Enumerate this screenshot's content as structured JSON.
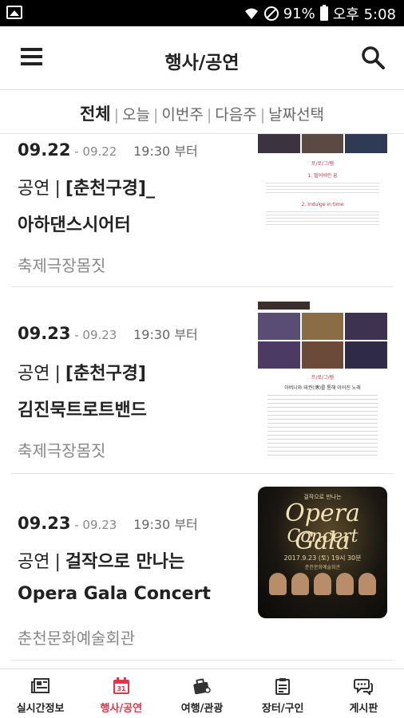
{
  "status": {
    "battery": "91%",
    "time": "오후 5:08"
  },
  "header": {
    "title": "행사/공연"
  },
  "filters": [
    {
      "label": "전체",
      "active": true
    },
    {
      "label": "오늘",
      "active": false
    },
    {
      "label": "이번주",
      "active": false
    },
    {
      "label": "다음주",
      "active": false
    },
    {
      "label": "날짜선택",
      "active": false
    }
  ],
  "filter_separator": "|",
  "events": [
    {
      "start": "09.22",
      "end": "- 09.22",
      "time": "19:30 부터",
      "category": "공연",
      "bar": "|",
      "name": "[춘천구경]_",
      "name2": "아하댄스시어터",
      "venue": "축제극장몸짓"
    },
    {
      "start": "09.23",
      "end": "- 09.23",
      "time": "19:30 부터",
      "category": "공연",
      "bar": "|",
      "name": "[춘천구경]",
      "name2": "김진묵트로트밴드",
      "venue": "축제극장몸짓"
    },
    {
      "start": "09.23",
      "end": "- 09.23",
      "time": "19:30 부터",
      "category": "공연",
      "bar": "|",
      "name": "걸작으로 만나는",
      "name2": "Opera Gala Concert",
      "venue": "춘천문화예술회관"
    }
  ],
  "thumbs": {
    "t1_heading": "프/로/그/램",
    "t1_sub1": "1. 떨어바린 꿈",
    "t1_sub2": "2. Indulge in time",
    "t2_heading": "프/로/그/램",
    "t2_sub": "아버니와 태권(溥)를 통해 이어진 노래",
    "poster_kicker": "걸작으로 만나는",
    "poster_title1": "Opera Gala",
    "poster_title2": "Concert",
    "poster_date": "2017.9.23 (토) 19시 30분",
    "poster_venue": "춘천문화예술회관"
  },
  "nav": [
    {
      "label": "실시간정보",
      "icon": "newspaper-icon",
      "active": false
    },
    {
      "label": "행사/공연",
      "icon": "calendar-icon",
      "active": true
    },
    {
      "label": "여행/관광",
      "icon": "suitcase-icon",
      "active": false
    },
    {
      "label": "장터/구인",
      "icon": "clipboard-icon",
      "active": false
    },
    {
      "label": "게시판",
      "icon": "chat-icon",
      "active": false
    }
  ],
  "colors": {
    "accent": "#e0344a",
    "text": "#222222",
    "muted": "#888888",
    "statusbar": "#000000"
  }
}
